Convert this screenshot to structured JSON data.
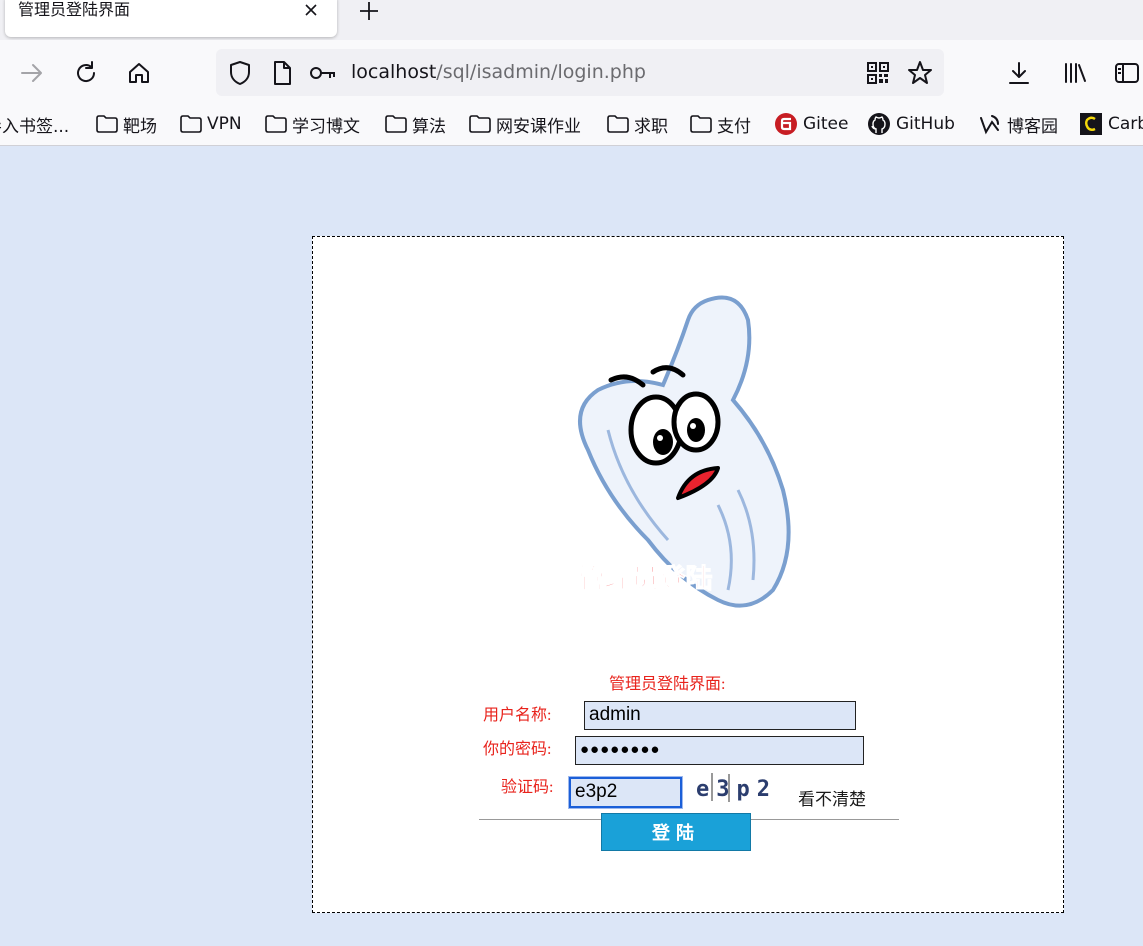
{
  "browser": {
    "tab_title": "管理员登陆界面",
    "url_host": "localhost",
    "url_path": "/sql/isadmin/login.php"
  },
  "bookmarks": [
    {
      "label": "导入书签...",
      "icon": "folder-icon"
    },
    {
      "label": "靶场",
      "icon": "folder-icon"
    },
    {
      "label": "VPN",
      "icon": "folder-icon"
    },
    {
      "label": "学习博文",
      "icon": "folder-icon"
    },
    {
      "label": "算法",
      "icon": "folder-icon"
    },
    {
      "label": "网安课作业",
      "icon": "folder-icon"
    },
    {
      "label": "求职",
      "icon": "folder-icon"
    },
    {
      "label": "支付",
      "icon": "folder-icon"
    },
    {
      "label": "Gitee",
      "icon": "gitee-icon"
    },
    {
      "label": "GitHub",
      "icon": "github-icon"
    },
    {
      "label": "博客园",
      "icon": "cnblogs-icon"
    },
    {
      "label": "Carb",
      "icon": "carbon-icon"
    }
  ],
  "login": {
    "mascot_caption": "管理员登陆",
    "form_title": "管理员登陆界面:",
    "username_label": "用户名称:",
    "username_value": "admin",
    "password_label": "你的密码:",
    "password_value": "●●●●●●●●",
    "captcha_label": "验证码:",
    "captcha_value": "e3p2",
    "captcha_image_text": "e3p2",
    "refresh_label": "看不清楚",
    "submit_label": "登陆"
  },
  "colors": {
    "page_bg": "#dce6f7",
    "label_red": "#e8231c",
    "button_blue": "#1aa1d8"
  }
}
